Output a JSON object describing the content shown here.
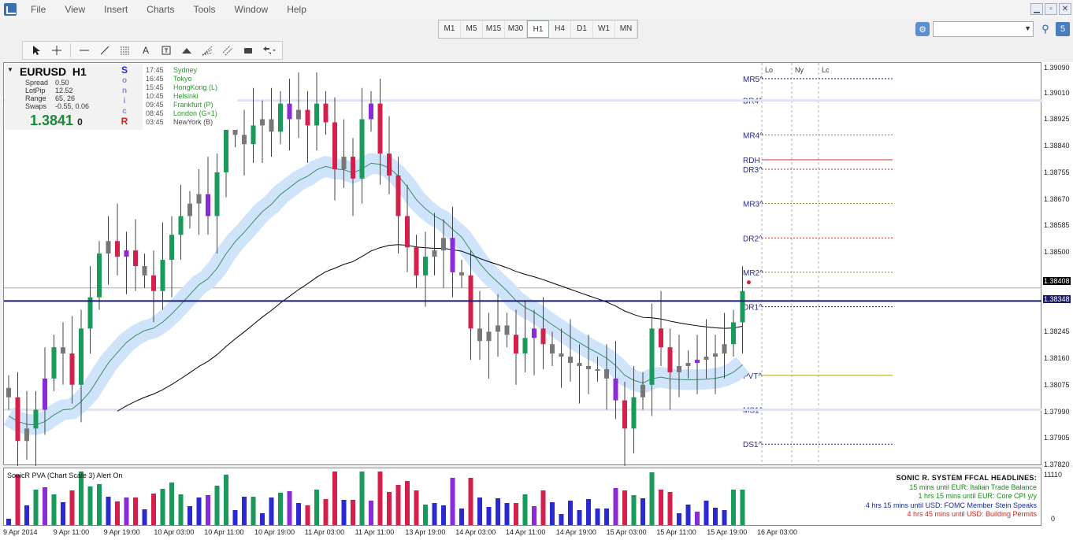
{
  "menu": {
    "items": [
      "File",
      "View",
      "Insert",
      "Charts",
      "Tools",
      "Window",
      "Help"
    ]
  },
  "window_controls": {
    "minimize": "▁",
    "restore": "▫",
    "close": "✕"
  },
  "timeframes": {
    "items": [
      "M1",
      "M5",
      "M15",
      "M30",
      "H1",
      "H4",
      "D1",
      "W1",
      "MN"
    ],
    "active": "H1"
  },
  "search": {
    "value": "",
    "badge": "5"
  },
  "toolbar": {
    "icons": [
      "cursor-icon",
      "crosshair-icon",
      "hline-icon",
      "trendline-icon",
      "fibo-icon",
      "text-icon",
      "label-icon",
      "triangle-icon",
      "fibfan-icon",
      "channel-icon",
      "rect-icon",
      "arrows-icon"
    ],
    "text_tool": "A"
  },
  "info": {
    "symbol": "EURUSD",
    "tf": "H1",
    "spread_label": "Spread",
    "spread": "0.50",
    "lotpip_label": "LotPip",
    "lotpip": "12.52",
    "range_label": "Range",
    "range": "65, 26",
    "swaps_label": "Swaps",
    "swaps": "-0.55, 0.06",
    "price": "1.3841",
    "price_suffix": "0",
    "logo": [
      "S",
      "o",
      "n",
      "i",
      "c",
      "R"
    ]
  },
  "sessions": [
    {
      "time": "17:45",
      "name": "Sydney"
    },
    {
      "time": "16:45",
      "name": "Tokyo"
    },
    {
      "time": "15:45",
      "name": "HongKong  (L)"
    },
    {
      "time": "10:45",
      "name": "Helsinki"
    },
    {
      "time": "09:45",
      "name": "Frankfurt  (P)"
    },
    {
      "time": "08:45",
      "name": "London  (G+1)"
    },
    {
      "time": "03:45",
      "name": "NewYork  (B)"
    }
  ],
  "levels": [
    {
      "label": "MR5^",
      "price": 1.3906,
      "color": "#2a2a88"
    },
    {
      "label": "DR4^",
      "price": 1.3899,
      "color": "#c03030"
    },
    {
      "label": "MR4^",
      "price": 1.3888,
      "color": "#888820"
    },
    {
      "label": "RDH",
      "price": 1.388,
      "color": "#d03030"
    },
    {
      "label": "DR3^",
      "price": 1.3877,
      "color": "#c03030"
    },
    {
      "label": "MR3^",
      "price": 1.3866,
      "color": "#888820"
    },
    {
      "label": "DR2^",
      "price": 1.3855,
      "color": "#c03030"
    },
    {
      "label": "MR2^",
      "price": 1.3844,
      "color": "#888820"
    },
    {
      "label": "DR1^",
      "price": 1.3833,
      "color": "#2a2a88"
    },
    {
      "label": "PVT^",
      "price": 1.3811,
      "color": "#b8a000"
    },
    {
      "label": "MS1^",
      "price": 1.38,
      "color": "#888820"
    },
    {
      "label": "DS1^",
      "price": 1.3789,
      "color": "#2a2a88"
    }
  ],
  "session_markers": [
    "Lo",
    "Ny",
    "Lc"
  ],
  "price_axis": {
    "ticks": [
      "1.39090",
      "1.39010",
      "1.38925",
      "1.38840",
      "1.38755",
      "1.38670",
      "1.38585",
      "1.38500",
      "1.38408",
      "1.38348",
      "1.38245",
      "1.38160",
      "1.38075",
      "1.37990",
      "1.37905",
      "1.37820"
    ],
    "current": "1.38408",
    "line_price": "1.38348"
  },
  "indicator": {
    "title": "SonicR PVA  (Chart Scale 3)   Alert On",
    "axis_top": "11110",
    "axis_bottom": "0"
  },
  "headlines": {
    "title": "SONIC R. SYSTEM  FFCAL HEADLINES:",
    "items": [
      {
        "text": "15 mins until EUR: Italian Trade Balance",
        "color": "#1a8a1a"
      },
      {
        "text": "1 hrs 15 mins until EUR: Core CPI y/y",
        "color": "#1a8a1a"
      },
      {
        "text": "4 hrs 15 mins until USD: FOMC Member Stein Speaks",
        "color": "#1a2a9a"
      },
      {
        "text": "4 hrs 45 mins until USD: Building Permits",
        "color": "#d02020"
      }
    ]
  },
  "time_axis": [
    "9 Apr 2014",
    "9 Apr 11:00",
    "9 Apr 19:00",
    "10 Apr 03:00",
    "10 Apr 11:00",
    "10 Apr 19:00",
    "11 Apr 03:00",
    "11 Apr 11:00",
    "13 Apr 19:00",
    "14 Apr 03:00",
    "14 Apr 11:00",
    "14 Apr 19:00",
    "15 Apr 03:00",
    "15 Apr 11:00",
    "15 Apr 19:00",
    "16 Apr 03:00"
  ],
  "chart_data": {
    "type": "candlestick",
    "symbol": "EURUSD",
    "timeframe": "H1",
    "ylim": [
      1.3782,
      1.3911
    ],
    "closes": [
      1.3804,
      1.379,
      1.3794,
      1.38,
      1.381,
      1.382,
      1.3818,
      1.3808,
      1.3826,
      1.3836,
      1.385,
      1.3854,
      1.3849,
      1.3851,
      1.3846,
      1.3843,
      1.3838,
      1.3848,
      1.3856,
      1.3862,
      1.3866,
      1.3869,
      1.3862,
      1.3876,
      1.389,
      1.3888,
      1.3885,
      1.3891,
      1.3893,
      1.3889,
      1.3898,
      1.3893,
      1.3896,
      1.3891,
      1.3898,
      1.3892,
      1.3877,
      1.3881,
      1.3874,
      1.3893,
      1.3898,
      1.3882,
      1.3875,
      1.3862,
      1.3852,
      1.3843,
      1.3849,
      1.3851,
      1.3855,
      1.3844,
      1.3843,
      1.3826,
      1.3822,
      1.3825,
      1.3827,
      1.3824,
      1.3818,
      1.3823,
      1.3826,
      1.3821,
      1.3818,
      1.3817,
      1.3815,
      1.3814,
      1.3813,
      1.3813,
      1.381,
      1.3803,
      1.3794,
      1.3804,
      1.3808,
      1.3826,
      1.382,
      1.3812,
      1.3814,
      1.3815,
      1.3816,
      1.3817,
      1.3818,
      1.3821,
      1.3828,
      1.3838
    ],
    "moving_averages": [
      {
        "name": "",
        "color": "#3a8a6a"
      },
      {
        "name": "",
        "color": "#000000"
      }
    ],
    "volume": "SonicR PVA"
  }
}
